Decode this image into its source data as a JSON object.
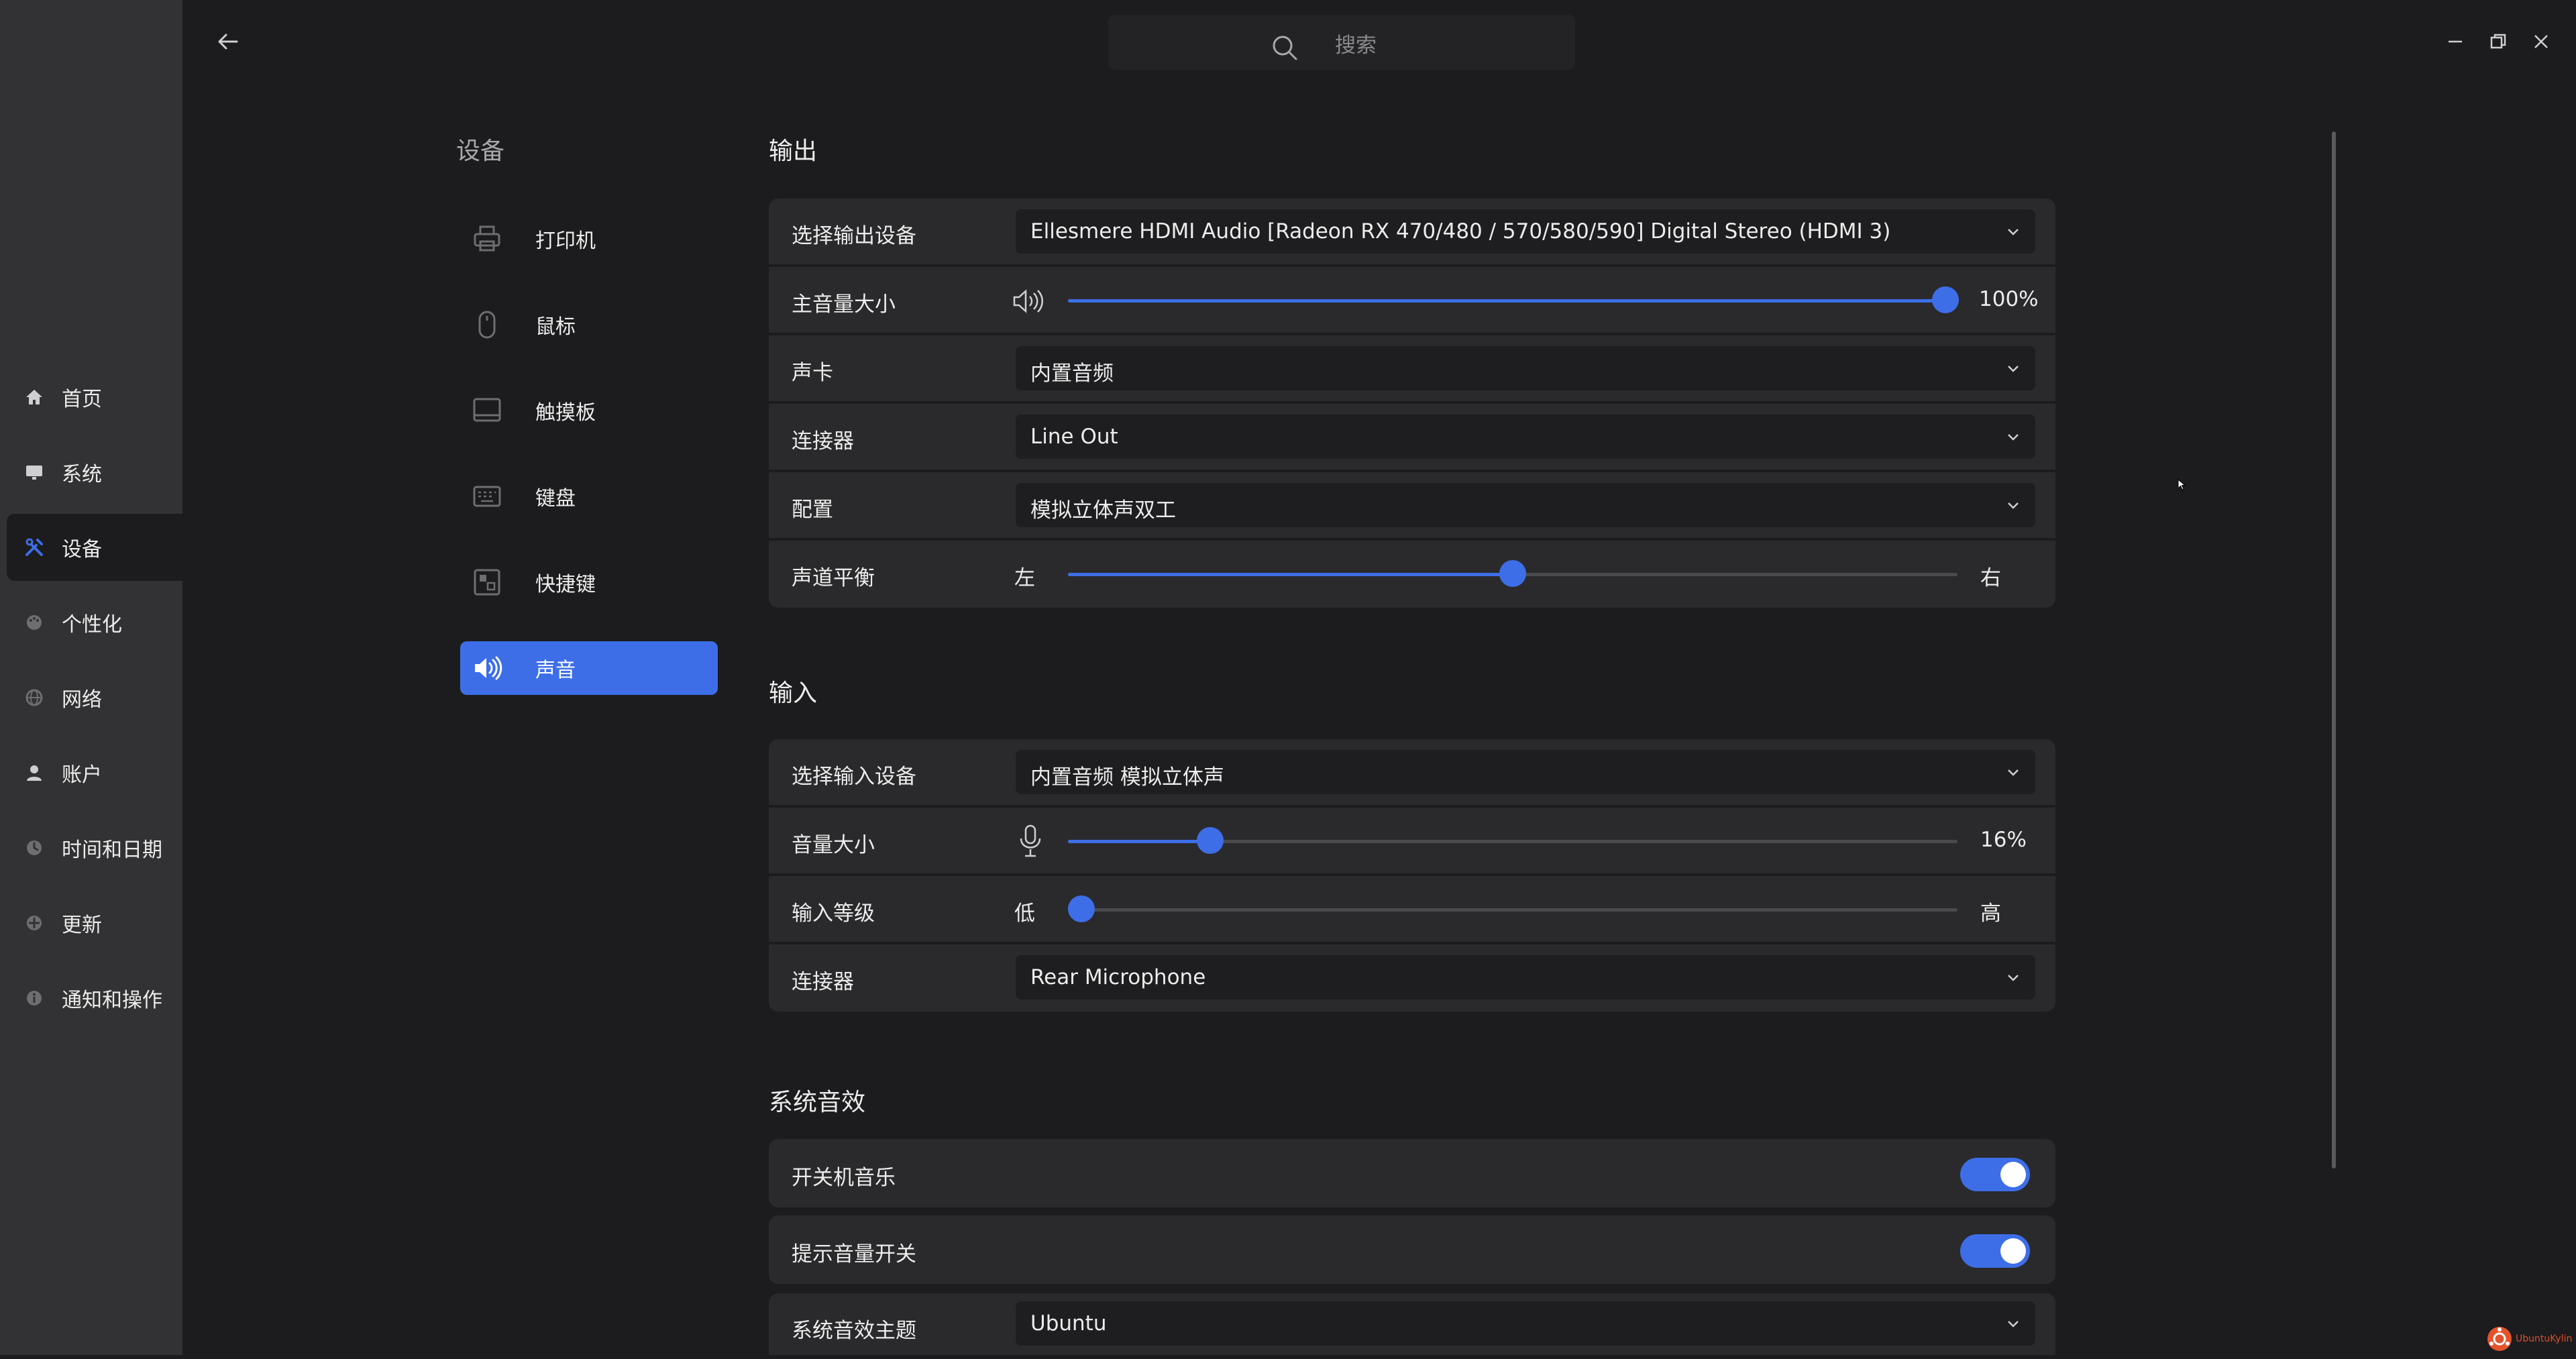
{
  "colors": {
    "accent": "#3d6ee8",
    "brand": "#e3542d"
  },
  "search": {
    "placeholder": "搜索"
  },
  "nav": {
    "items": [
      {
        "label": "首页",
        "icon": "home-icon"
      },
      {
        "label": "系统",
        "icon": "monitor-icon"
      },
      {
        "label": "设备",
        "icon": "tools-icon",
        "active": true
      },
      {
        "label": "个性化",
        "icon": "palette-icon"
      },
      {
        "label": "网络",
        "icon": "globe-icon"
      },
      {
        "label": "账户",
        "icon": "user-icon"
      },
      {
        "label": "时间和日期",
        "icon": "clock-icon"
      },
      {
        "label": "更新",
        "icon": "update-icon"
      },
      {
        "label": "通知和操作",
        "icon": "info-icon"
      }
    ]
  },
  "subnav": {
    "title": "设备",
    "items": [
      {
        "label": "打印机",
        "icon": "printer-icon"
      },
      {
        "label": "鼠标",
        "icon": "mouse-icon"
      },
      {
        "label": "触摸板",
        "icon": "touchpad-icon"
      },
      {
        "label": "键盘",
        "icon": "keyboard-icon"
      },
      {
        "label": "快捷键",
        "icon": "shortcut-icon"
      },
      {
        "label": "声音",
        "icon": "speaker-icon",
        "active": true
      }
    ]
  },
  "output": {
    "title": "输出",
    "device_label": "选择输出设备",
    "device_value": "Ellesmere HDMI Audio [Radeon RX 470/480 / 570/580/590] Digital Stereo (HDMI 3)",
    "volume_label": "主音量大小",
    "volume": 1.0,
    "volume_text": "100%",
    "card_label": "声卡",
    "card_value": "内置音频",
    "connector_label": "连接器",
    "connector_value": "Line Out",
    "profile_label": "配置",
    "profile_value": "模拟立体声双工",
    "balance_label": "声道平衡",
    "balance": 0.5,
    "balance_left": "左",
    "balance_right": "右"
  },
  "input": {
    "title": "输入",
    "device_label": "选择输入设备",
    "device_value": "内置音频 模拟立体声",
    "volume_label": "音量大小",
    "volume": 0.16,
    "volume_text": "16%",
    "level_label": "输入等级",
    "level": 0.0,
    "level_low": "低",
    "level_high": "高",
    "connector_label": "连接器",
    "connector_value": "Rear Microphone"
  },
  "system_sounds": {
    "title": "系统音效",
    "boot_label": "开关机音乐",
    "boot_on": true,
    "alert_label": "提示音量开关",
    "alert_on": true,
    "theme_label": "系统音效主题",
    "theme_value": "Ubuntu"
  },
  "brand": {
    "text": "UbuntuKylin"
  }
}
